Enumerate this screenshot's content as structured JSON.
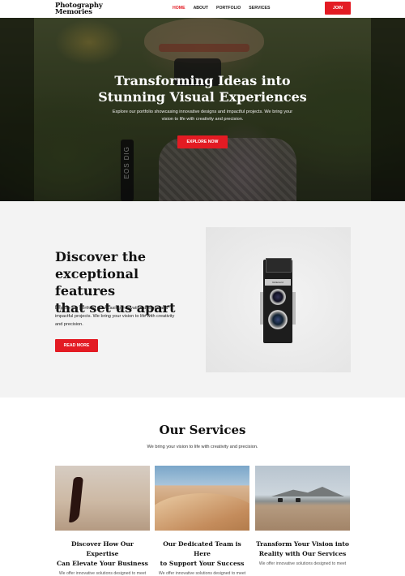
{
  "header": {
    "logo_line1": "Photography",
    "logo_line2": "Memories",
    "nav": [
      "HOME",
      "ABOUT",
      "PORTFOLIO",
      "SERVICES"
    ],
    "active_nav": "HOME",
    "join_label": "JOIN"
  },
  "hero": {
    "title_line1": "Transforming Ideas into",
    "title_line2": "Stunning Visual Experiences",
    "subtitle_line1": "Explore our portfolio showcasing innovative designs and impactful projects. We bring your",
    "subtitle_line2": "vision to life with creativity and precision.",
    "button_label": "EXPLORE NOW",
    "strap_text": "EOS DIG"
  },
  "features": {
    "title_line1": "Discover the",
    "title_line2": "exceptional features",
    "title_line3": "that set us apart",
    "text_line1": "Explore our portfolio showcasing innovative designs and",
    "text_line2": "impactful projects. We bring your vision to life with creativity",
    "text_line3": "and precision.",
    "button_label": "READ MORE",
    "camera_plate": "Rolleicord"
  },
  "services": {
    "title": "Our Services",
    "subtitle": "We bring your vision to life with creativity and precision.",
    "cards": [
      {
        "title_line1": "Discover How Our Expertise",
        "title_line2": "Can Elevate Your Business",
        "desc": "We offer innovative solutions designed to meet"
      },
      {
        "title_line1": "Our Dedicated Team is Here",
        "title_line2": "to Support Your Success",
        "desc": "We offer innovative solutions designed to meet"
      },
      {
        "title_line1": "Transform Your Vision into",
        "title_line2": "Reality with Our Services",
        "desc": "We offer innovative solutions designed to meet"
      }
    ]
  },
  "colors": {
    "accent": "#e31b23",
    "features_bg": "#f3f3f3"
  }
}
